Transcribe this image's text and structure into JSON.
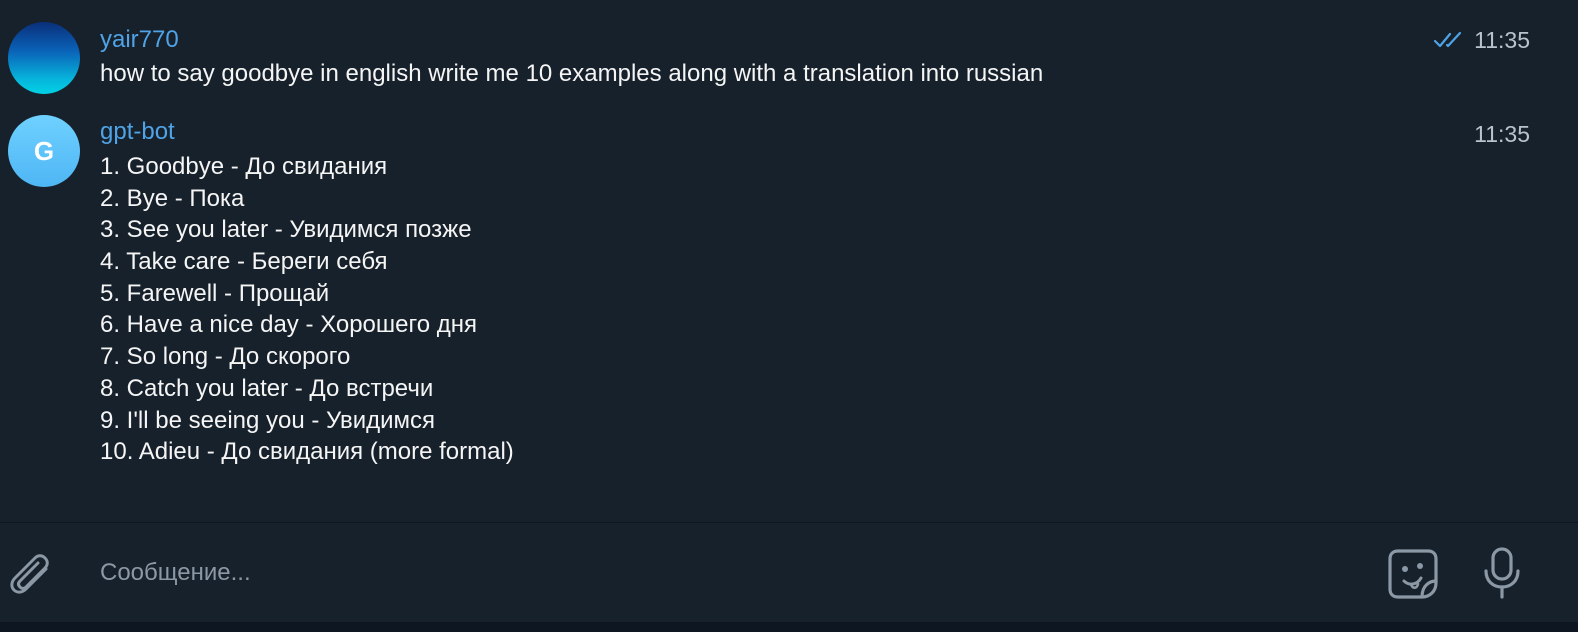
{
  "colors": {
    "background": "#17212b",
    "author_accent": "#4fa3e6",
    "checkmarks": "#4fa3e6",
    "time_text": "#b9c3cc",
    "placeholder": "#8b98a5",
    "icon_gray": "#8b98a5"
  },
  "messages": [
    {
      "author": "yair770",
      "time": "11:35",
      "status_icon": "double-check-icon",
      "text": "how to say goodbye in english write me 10 examples along with a translation into russian"
    },
    {
      "author": "gpt-bot",
      "avatar_initial": "G",
      "time": "11:35",
      "lines": [
        "1. Goodbye - До свидания",
        "2. Bye - Пока",
        "3. See you later - Увидимся позже",
        "4. Take care - Береги себя",
        "5. Farewell - Прощай",
        "6. Have a nice day - Хорошего дня",
        "7. So long - До скорого",
        "8. Catch you later - До встречи",
        "9. I'll be seeing you - Увидимся",
        "10. Adieu - До свидания (more formal)"
      ]
    }
  ],
  "composer": {
    "placeholder": "Сообщение...",
    "value": "",
    "attach_icon": "paperclip-icon",
    "emoji_icon": "sticker-emoji-icon",
    "mic_icon": "microphone-icon"
  }
}
